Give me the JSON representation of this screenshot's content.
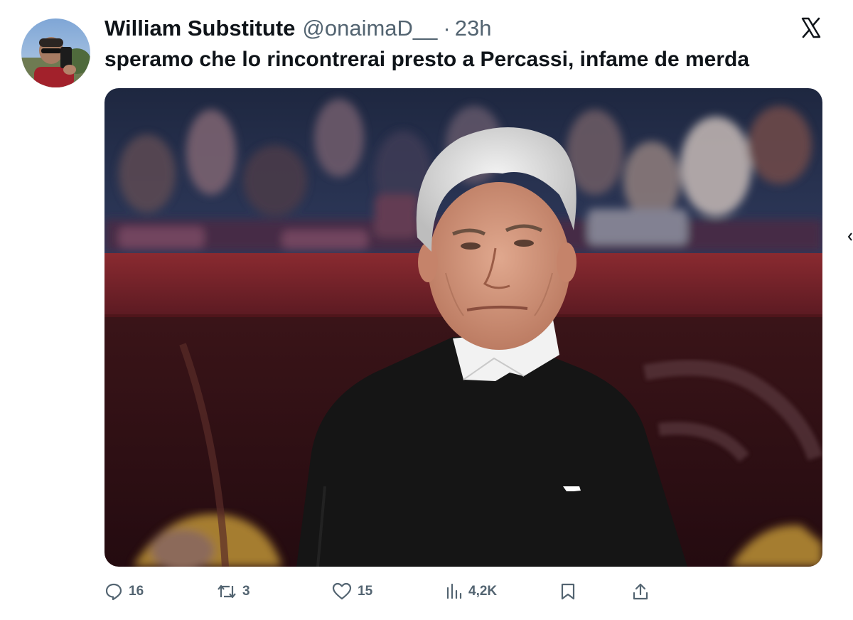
{
  "tweet": {
    "author": {
      "display_name": "William Substitute",
      "handle": "@onaimaD__",
      "separator": "·",
      "time": "23h",
      "avatar_icon": "profile-photo"
    },
    "text": "speramo che lo rincontrerai presto a Percassi, infame de merda",
    "media": {
      "type": "photo",
      "description_icon": "photo-of-man-in-black-sweater-at-stadium"
    },
    "actions": {
      "reply": {
        "icon": "reply-icon",
        "count": "16"
      },
      "retweet": {
        "icon": "retweet-icon",
        "count": "3"
      },
      "like": {
        "icon": "heart-icon",
        "count": "15"
      },
      "views": {
        "icon": "views-icon",
        "count": "4,2K"
      },
      "bookmark": {
        "icon": "bookmark-icon"
      },
      "share": {
        "icon": "share-icon"
      }
    }
  },
  "brand": {
    "icon": "x-logo-icon"
  },
  "colors": {
    "text_primary": "#0f1419",
    "text_secondary": "#536471",
    "background": "#ffffff"
  }
}
